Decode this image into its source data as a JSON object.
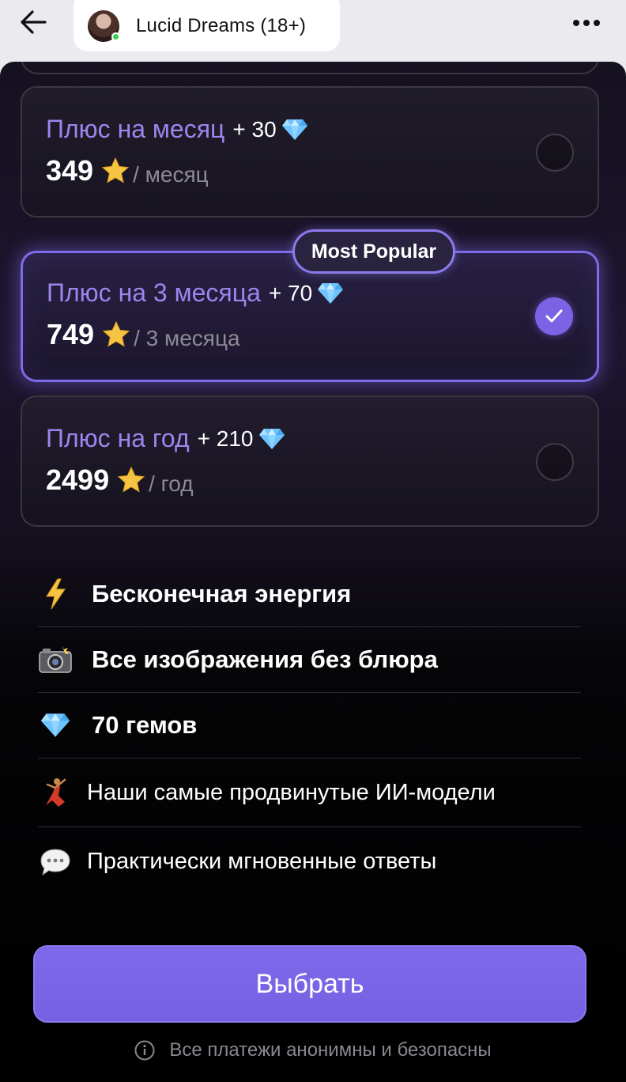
{
  "header": {
    "title": "Lucid Dreams (18+)",
    "back_icon": "arrow-left-icon",
    "more_icon": "more-horizontal-icon"
  },
  "plans": [
    {
      "name": "Плюс на месяц",
      "bonus": "+ 30",
      "price": "349",
      "period": "/ месяц",
      "selected": false
    },
    {
      "name": "Плюс на 3 месяца",
      "bonus": "+ 70",
      "price": "749",
      "period": "/ 3 месяца",
      "selected": true
    },
    {
      "name": "Плюс на год",
      "bonus": "+ 210",
      "price": "2499",
      "period": "/ год",
      "selected": false
    }
  ],
  "badge": "Most Popular",
  "features": [
    {
      "icon": "lightning-icon",
      "text": "Бесконечная энергия"
    },
    {
      "icon": "camera-flash-icon",
      "text": "Все изображения без блюра"
    },
    {
      "icon": "gem-icon",
      "text": "70 гемов"
    },
    {
      "icon": "dancer-icon",
      "text": "Наши самые продвинутые ИИ-модели"
    },
    {
      "icon": "speech-bubble-icon",
      "text": "Практически мгновенные ответы"
    }
  ],
  "cta_label": "Выбрать",
  "footnote": "Все платежи анонимны и безопасны",
  "colors": {
    "accent": "#7b63e6",
    "plan_name": "#9b86ee",
    "background": "#000000"
  }
}
